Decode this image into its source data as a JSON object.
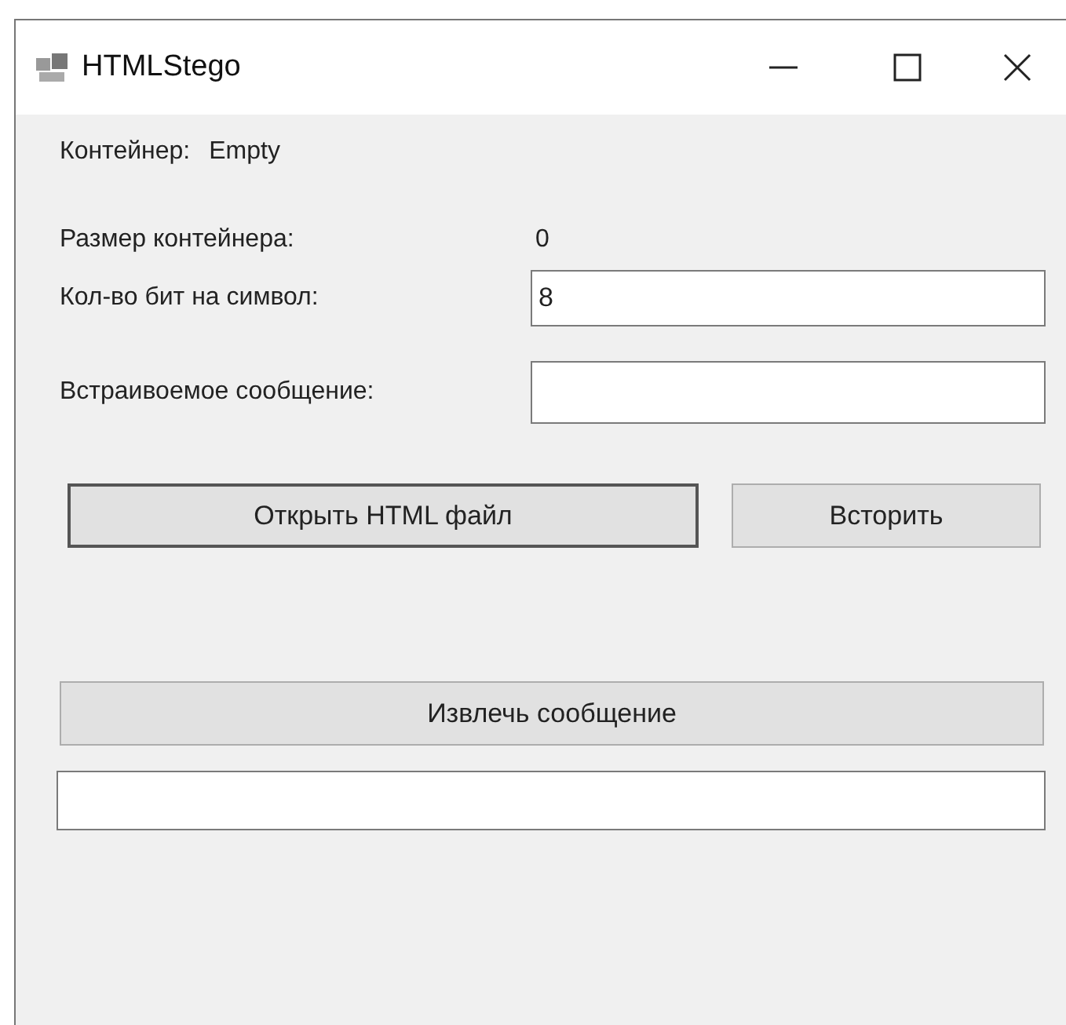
{
  "window": {
    "title": "HTMLStego"
  },
  "container": {
    "label": "Контейнер:",
    "value": "Empty"
  },
  "size": {
    "label": "Размер контейнера:",
    "value": "0"
  },
  "bits": {
    "label": "Кол-во бит на символ:",
    "value": "8"
  },
  "message": {
    "label": "Встраивоемое сообщение:"
  },
  "buttons": [
    {
      "label": "Открыть HTML файл",
      "focused": true
    },
    {
      "label": "Всторить",
      "focused": false
    }
  ],
  "extract": {
    "label": "Извлечь сообщение"
  }
}
